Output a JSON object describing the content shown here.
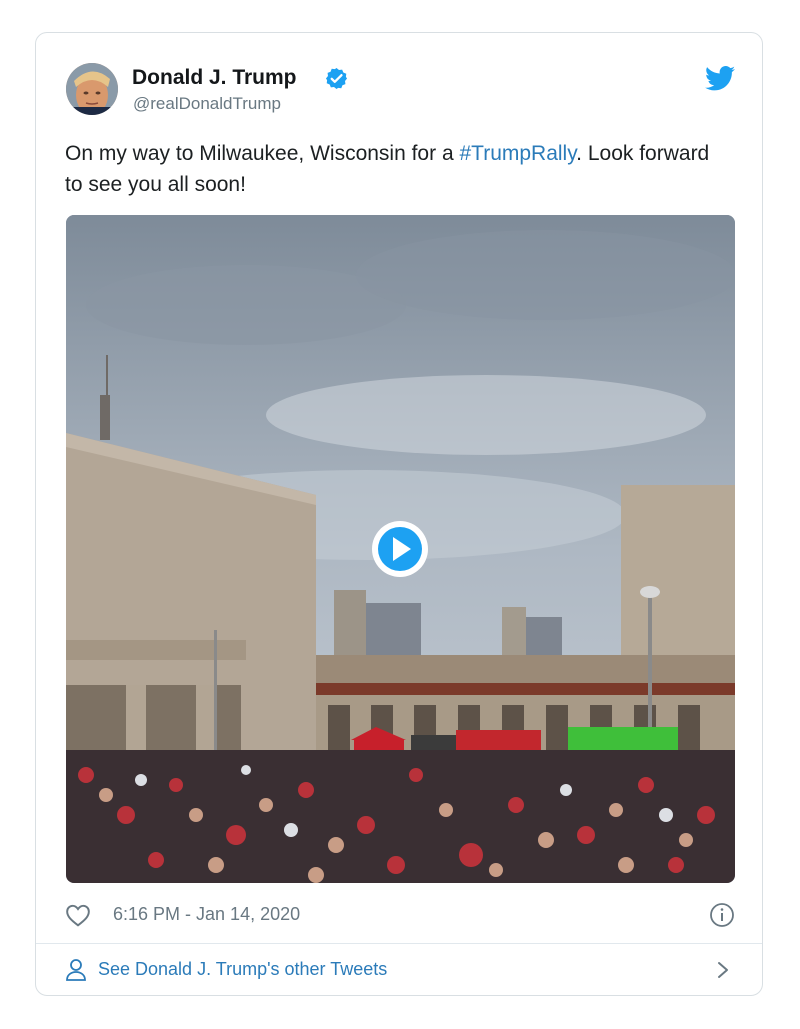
{
  "author": {
    "name": "Donald J. Trump",
    "handle": "@realDonaldTrump"
  },
  "tweet": {
    "text_before": "On my way to Milwaukee, Wisconsin for a ",
    "hashtag": "#TrumpRally",
    "text_after": ". Look forward to see you all soon!"
  },
  "timestamp": "6:16 PM - Jan 14, 2020",
  "footer": {
    "link_label": "See Donald J. Trump's other Tweets"
  },
  "colors": {
    "link": "#2b7bb9",
    "verified": "#1da1f2",
    "muted": "#697882"
  },
  "icons": [
    "verified-badge-icon",
    "twitter-bird-icon",
    "play-icon",
    "heart-icon",
    "info-icon",
    "person-icon",
    "chevron-right-icon"
  ]
}
